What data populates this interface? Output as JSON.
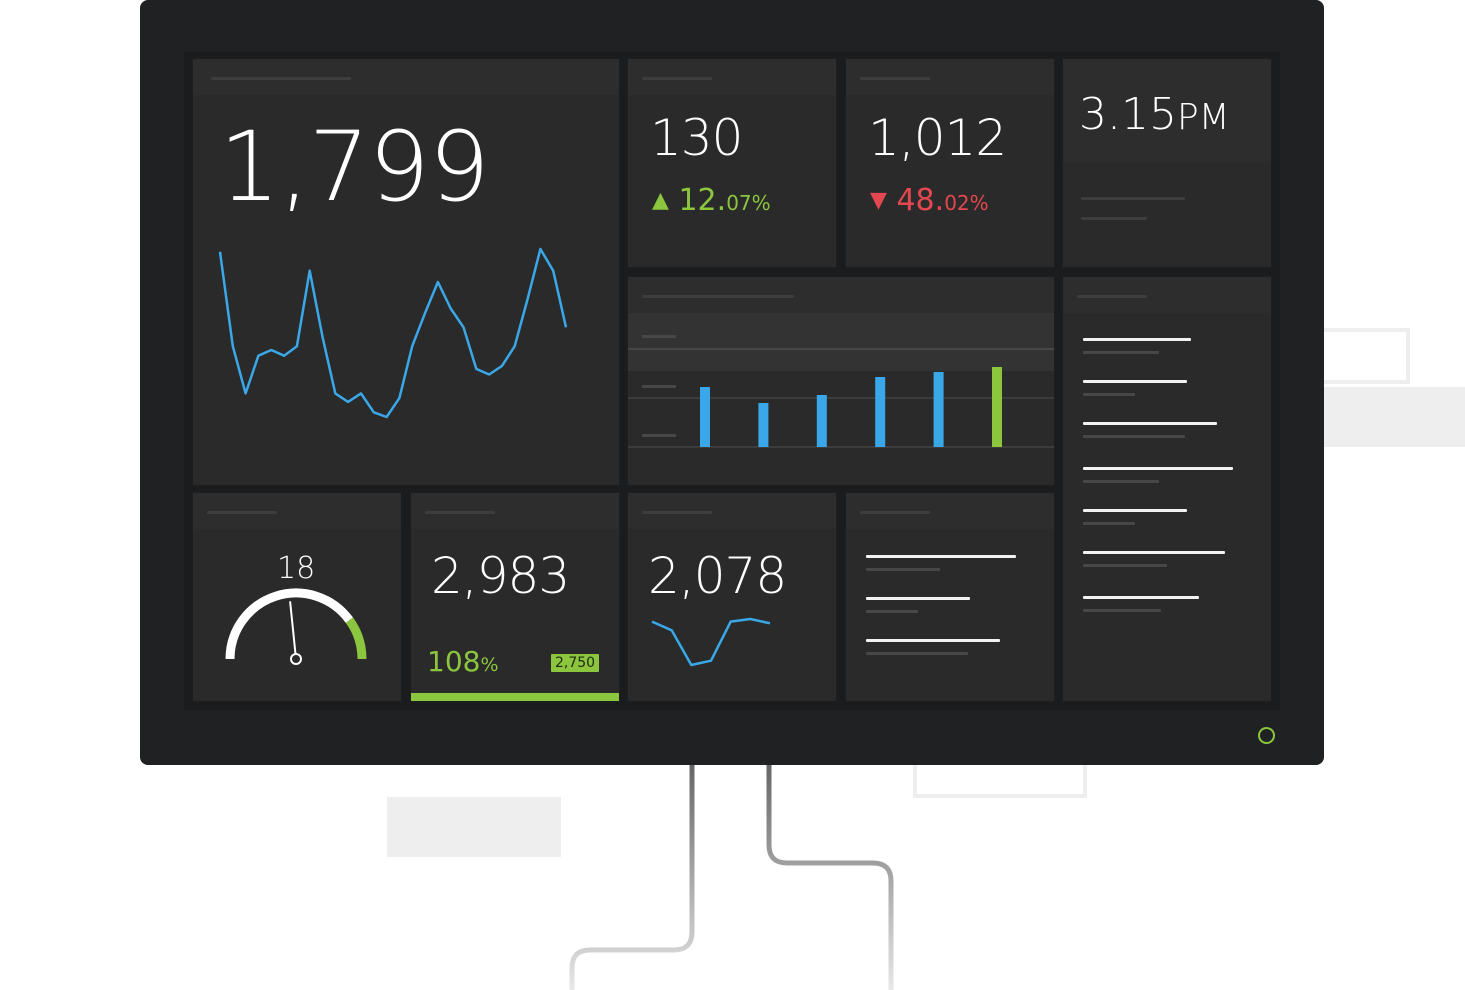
{
  "colors": {
    "accent_blue": "#3aa8e8",
    "accent_green": "#8cc63f",
    "accent_red": "#e3474f",
    "tile": "#2a2a2a",
    "bezel": "#202122"
  },
  "dashboard": {
    "main_metric": {
      "value": "1,799",
      "sparkline": [
        400,
        300,
        250,
        290,
        296,
        290,
        300,
        380,
        310,
        250,
        241,
        250,
        230,
        225,
        245,
        300,
        335,
        368,
        340,
        320,
        276,
        270,
        279,
        300,
        350,
        403,
        380,
        320
      ]
    },
    "metric_up": {
      "value": "130",
      "arrow": "▲",
      "delta_int": "12.",
      "delta_dec": "07%",
      "direction": "up"
    },
    "metric_down": {
      "value": "1,012",
      "arrow": "▼",
      "delta_int": "48.",
      "delta_dec": "02%",
      "direction": "down"
    },
    "clock": {
      "time": "3.15",
      "meridiem": "PM"
    },
    "bar_chart": {
      "bars": [
        {
          "value": 60,
          "color": "#3aa8e8"
        },
        {
          "value": 44,
          "color": "#3aa8e8"
        },
        {
          "value": 52,
          "color": "#3aa8e8"
        },
        {
          "value": 70,
          "color": "#3aa8e8"
        },
        {
          "value": 75,
          "color": "#3aa8e8"
        },
        {
          "value": 80,
          "color": "#8cc63f"
        }
      ],
      "max": 100
    },
    "gauge": {
      "value": "18",
      "level": 0.85
    },
    "goal": {
      "value": "2,983",
      "percent_int": "108",
      "percent_sign": "%",
      "target": "2,750",
      "progress": 1.0
    },
    "mini_chart": {
      "value": "2,078",
      "sparkline": [
        60,
        50,
        10,
        15,
        60,
        63,
        58
      ]
    }
  }
}
